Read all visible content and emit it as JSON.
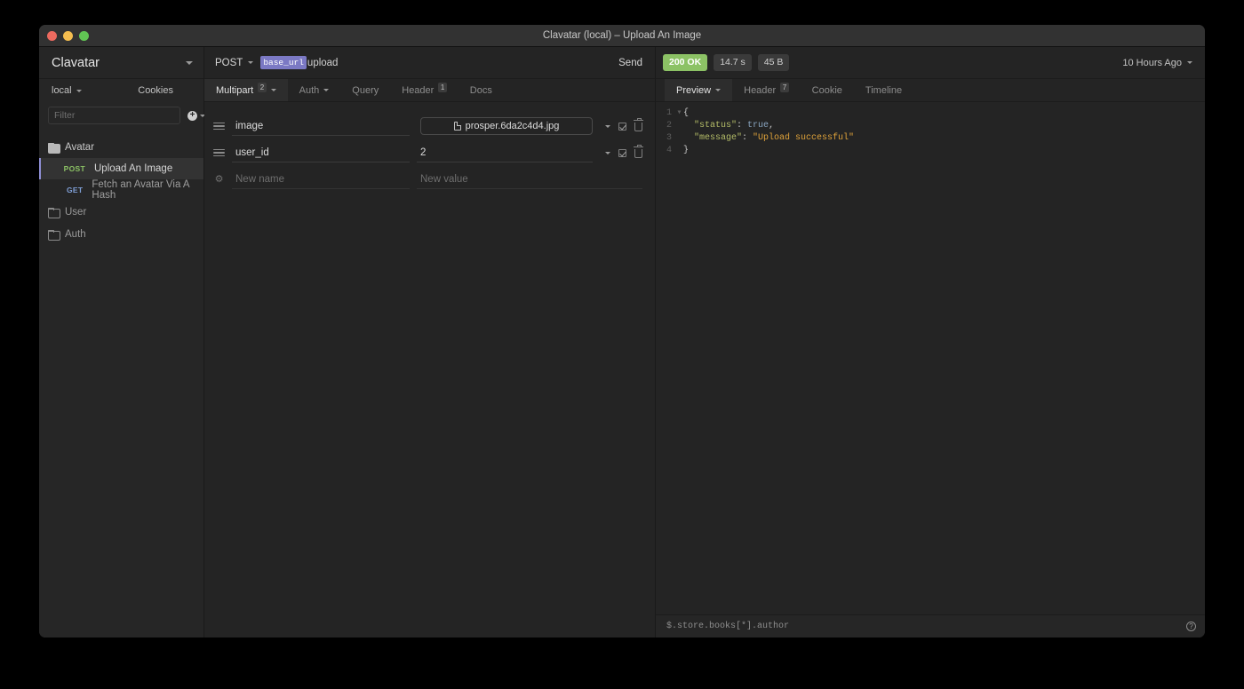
{
  "window": {
    "title": "Clavatar (local) – Upload An Image",
    "traffic_lights": [
      "close-red",
      "minimize-yellow",
      "zoom-green"
    ]
  },
  "sidebar": {
    "workspace_name": "Clavatar",
    "environment": "local",
    "cookies_label": "Cookies",
    "filter_placeholder": "Filter",
    "add_label": "+",
    "tree": [
      {
        "type": "folder",
        "name": "Avatar",
        "open": true,
        "items": [
          {
            "method": "POST",
            "name": "Upload An Image",
            "active": true
          },
          {
            "method": "GET",
            "name": "Fetch an Avatar Via A Hash",
            "active": false
          }
        ]
      },
      {
        "type": "folder",
        "name": "User",
        "open": false,
        "items": []
      },
      {
        "type": "folder",
        "name": "Auth",
        "open": false,
        "items": []
      }
    ]
  },
  "request": {
    "method": "POST",
    "url_variable": "base_url",
    "url_path": "upload",
    "send_label": "Send",
    "tabs": [
      {
        "label": "Multipart",
        "badge": "2",
        "active": true,
        "has_caret": true
      },
      {
        "label": "Auth",
        "badge": "",
        "active": false,
        "has_caret": true
      },
      {
        "label": "Query",
        "badge": "",
        "active": false,
        "has_caret": false
      },
      {
        "label": "Header",
        "badge": "1",
        "active": false,
        "has_caret": false
      },
      {
        "label": "Docs",
        "badge": "",
        "active": false,
        "has_caret": false
      }
    ],
    "multipart_rows": [
      {
        "name": "image",
        "value": "prosper.6da2c4d4.jpg",
        "is_file": true,
        "enabled": true
      },
      {
        "name": "user_id",
        "value": "2",
        "is_file": false,
        "enabled": true
      }
    ],
    "new_row": {
      "name_placeholder": "New name",
      "value_placeholder": "New value"
    }
  },
  "response": {
    "status": "200 OK",
    "time": "14.7 s",
    "size": "45 B",
    "history": "10 Hours Ago",
    "tabs": [
      {
        "label": "Preview",
        "badge": "",
        "active": true,
        "has_caret": true
      },
      {
        "label": "Header",
        "badge": "7",
        "active": false,
        "has_caret": false
      },
      {
        "label": "Cookie",
        "badge": "",
        "active": false,
        "has_caret": false
      },
      {
        "label": "Timeline",
        "badge": "",
        "active": false,
        "has_caret": false
      }
    ],
    "body_lines": [
      {
        "num": "1",
        "fold": "▾",
        "tokens": [
          {
            "t": "{",
            "c": "p"
          }
        ]
      },
      {
        "num": "2",
        "fold": "",
        "tokens": [
          {
            "t": "  \"status\"",
            "c": "k"
          },
          {
            "t": ": ",
            "c": "p"
          },
          {
            "t": "true",
            "c": "b"
          },
          {
            "t": ",",
            "c": "p"
          }
        ]
      },
      {
        "num": "3",
        "fold": "",
        "tokens": [
          {
            "t": "  \"message\"",
            "c": "k"
          },
          {
            "t": ": ",
            "c": "p"
          },
          {
            "t": "\"Upload successful\"",
            "c": "s"
          }
        ]
      },
      {
        "num": "4",
        "fold": "",
        "tokens": [
          {
            "t": "}",
            "c": "p"
          }
        ]
      }
    ],
    "jsonpath_value": "$.store.books[*].author",
    "help_label": "?"
  },
  "colors": {
    "accent_green": "#8cc265",
    "method_post": "#8cc265",
    "method_get": "#7f9fd6",
    "variable_chip": "#7b79c4",
    "json_key": "#b5bd68",
    "json_string": "#e0a33a",
    "json_boolean": "#8aa6c1"
  }
}
